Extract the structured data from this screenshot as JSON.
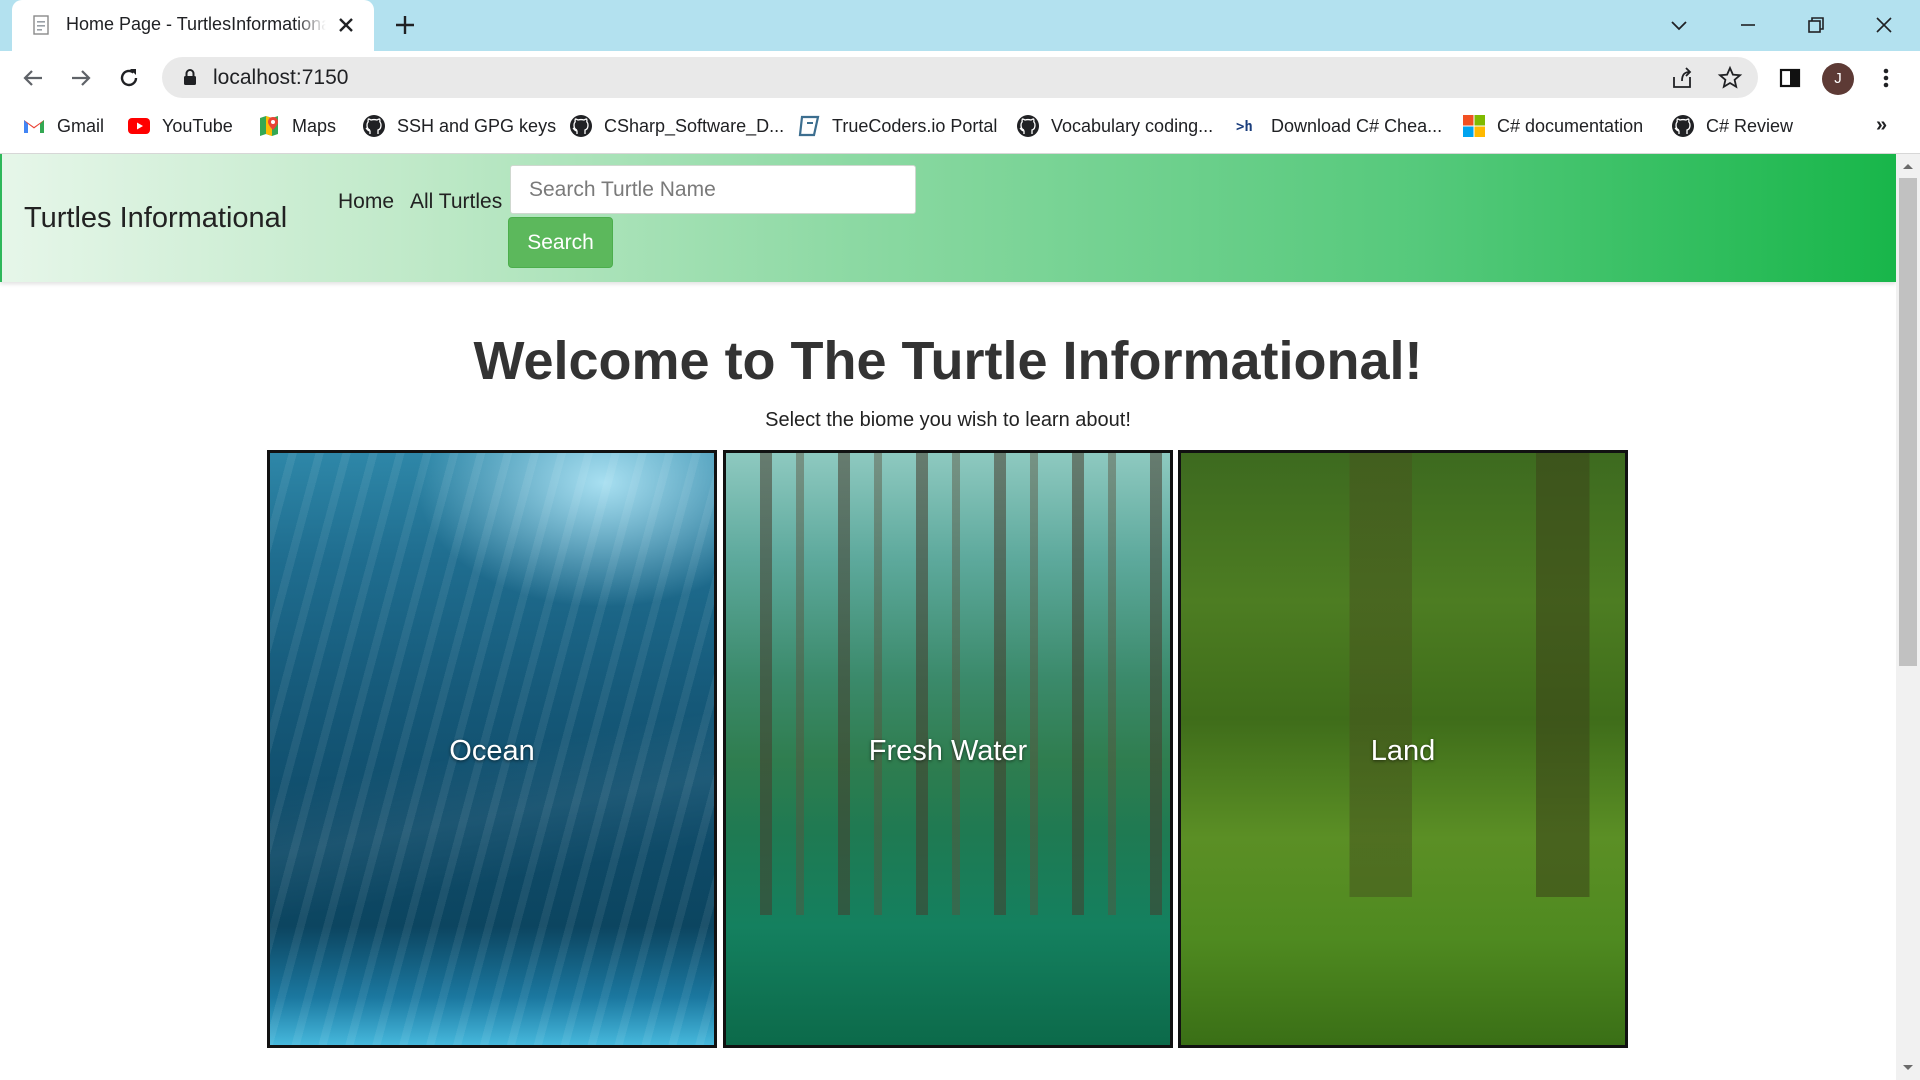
{
  "browser": {
    "tab": {
      "title": "Home Page - TurtlesInformational",
      "favicon": "document-icon"
    },
    "url": "localhost:7150",
    "avatar_letter": "J",
    "bookmarks": [
      {
        "label": "Gmail",
        "icon": "gmail-icon"
      },
      {
        "label": "YouTube",
        "icon": "youtube-icon"
      },
      {
        "label": "Maps",
        "icon": "maps-icon"
      },
      {
        "label": "SSH and GPG keys",
        "icon": "github-icon"
      },
      {
        "label": "CSharp_Software_D...",
        "icon": "github-icon"
      },
      {
        "label": "TrueCoders.io Portal",
        "icon": "truecoders-icon"
      },
      {
        "label": "Vocabulary coding...",
        "icon": "github-icon"
      },
      {
        "label": "Download C# Chea...",
        "icon": "terminal-icon"
      },
      {
        "label": "C# documentation",
        "icon": "microsoft-icon"
      },
      {
        "label": "C# Review",
        "icon": "github-icon"
      }
    ],
    "bookmarks_overflow": "»"
  },
  "navbar": {
    "brand": "Turtles Informational",
    "links": [
      "Home",
      "All Turtles"
    ],
    "search": {
      "placeholder": "Search Turtle Name",
      "value": "",
      "button": "Search"
    }
  },
  "main": {
    "title": "Welcome to The Turtle Informational!",
    "subtitle": "Select the biome you wish to learn about!",
    "biomes": [
      {
        "label": "Ocean"
      },
      {
        "label": "Fresh Water"
      },
      {
        "label": "Land"
      }
    ]
  },
  "colors": {
    "tabstrip": "#b3e1ef",
    "navbar_gradient_start": "#e6f6e9",
    "navbar_gradient_end": "#18b64a",
    "search_button": "#5cb85c"
  }
}
